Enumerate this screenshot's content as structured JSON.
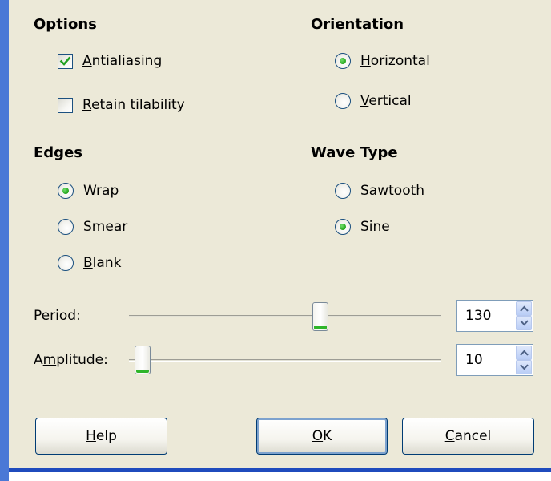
{
  "options": {
    "heading": "Options",
    "antialiasing": {
      "label_prefix": "",
      "label_mnemonic": "A",
      "label_rest": "ntialiasing",
      "checked": true
    },
    "retain_tilability": {
      "label_prefix": "",
      "label_mnemonic": "R",
      "label_rest": "etain tilability",
      "checked": false
    }
  },
  "orientation": {
    "heading": "Orientation",
    "horizontal": {
      "label_prefix": "",
      "label_mnemonic": "H",
      "label_rest": "orizontal",
      "selected": true
    },
    "vertical": {
      "label_prefix": "",
      "label_mnemonic": "V",
      "label_rest": "ertical",
      "selected": false
    }
  },
  "edges": {
    "heading": "Edges",
    "wrap": {
      "label_prefix": "",
      "label_mnemonic": "W",
      "label_rest": "rap",
      "selected": true
    },
    "smear": {
      "label_prefix": "",
      "label_mnemonic": "S",
      "label_rest": "mear",
      "selected": false
    },
    "blank": {
      "label_prefix": "",
      "label_mnemonic": "B",
      "label_rest": "lank",
      "selected": false
    }
  },
  "wave_type": {
    "heading": "Wave Type",
    "sawtooth": {
      "label_prefix": "Saw",
      "label_mnemonic": "t",
      "label_rest": "ooth",
      "selected": false
    },
    "sine": {
      "label_prefix": "S",
      "label_mnemonic": "i",
      "label_rest": "ne",
      "selected": true
    }
  },
  "period": {
    "label_prefix": "",
    "label_mnemonic": "P",
    "label_rest": "eriod:",
    "value": "130",
    "slider_fraction": 0.62
  },
  "amplitude": {
    "label_prefix": "A",
    "label_mnemonic": "m",
    "label_rest": "plitude:",
    "value": "10",
    "slider_fraction": 0.02
  },
  "buttons": {
    "help": {
      "label_prefix": "",
      "label_mnemonic": "H",
      "label_rest": "elp"
    },
    "ok": {
      "label_prefix": "",
      "label_mnemonic": "O",
      "label_rest": "K"
    },
    "cancel": {
      "label_prefix": "",
      "label_mnemonic": "C",
      "label_rest": "ancel"
    }
  },
  "colors": {
    "dialog_bg": "#ece9d8",
    "frame_blue": "#1f4bbd",
    "check_green": "#21a121",
    "radio_green": "#24a51c"
  },
  "icons": {
    "checkmark": "checkmark-icon",
    "spin_up": "arrow-up-icon",
    "spin_down": "arrow-down-icon"
  }
}
